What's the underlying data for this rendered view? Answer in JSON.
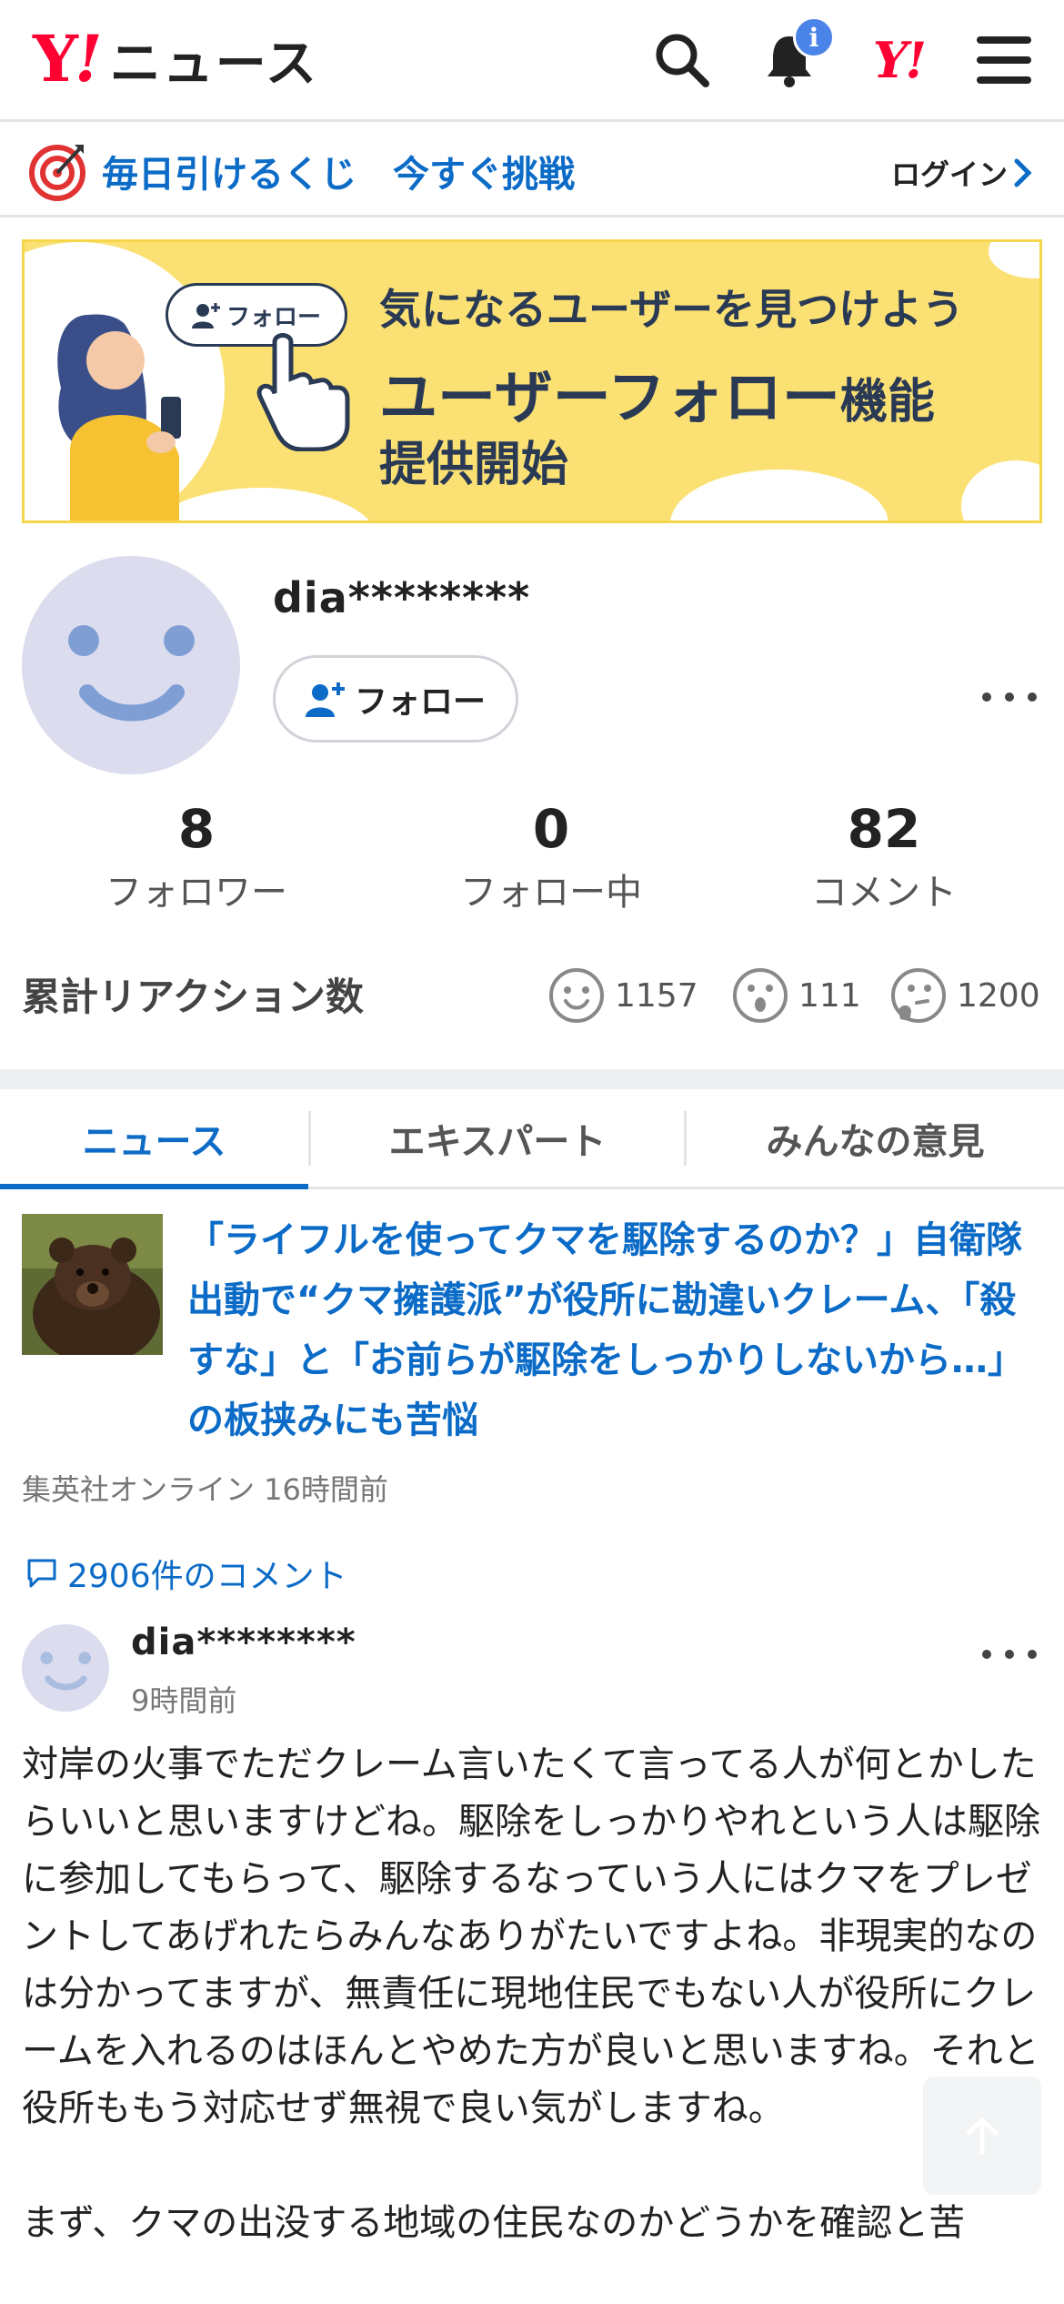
{
  "header": {
    "logo_y": "Y",
    "logo_excl": "!",
    "logo_text": "ニュース",
    "notification_badge": "i",
    "yahoo_mark": "Y!"
  },
  "lottery": {
    "text": "毎日引けるくじ　今すぐ挑戦",
    "login_label": "ログイン"
  },
  "banner": {
    "pill_label": "フォロー",
    "line1": "気になるユーザーを見つけよう",
    "line2_main": "ユーザーフォロー",
    "line2_small": "機能",
    "line3": "提供開始"
  },
  "profile": {
    "username": "dia********",
    "follow_label": "フォロー",
    "stats": [
      {
        "value": "8",
        "label": "フォロワー"
      },
      {
        "value": "0",
        "label": "フォロー中"
      },
      {
        "value": "82",
        "label": "コメント"
      }
    ],
    "reactions_title": "累計リアクション数",
    "reactions": [
      {
        "icon": "smile-icon",
        "count": "1157"
      },
      {
        "icon": "surprised-icon",
        "count": "111"
      },
      {
        "icon": "thinking-icon",
        "count": "1200"
      }
    ]
  },
  "tabs": [
    {
      "label": "ニュース",
      "active": true
    },
    {
      "label": "エキスパート",
      "active": false
    },
    {
      "label": "みんなの意見",
      "active": false
    }
  ],
  "article": {
    "title": "「ライフルを使ってクマを駆除するのか？」自衛隊出動で“クマ擁護派”が役所に勘違いクレーム、「殺すな」と「お前らが駆除をしっかりしないから…」の板挟みにも苦悩",
    "source": "集英社オンライン 16時間前",
    "comment_count": "2906件のコメント"
  },
  "comment": {
    "username": "dia********",
    "time": "9時間前",
    "body1": "対岸の火事でただクレーム言いたくて言ってる人が何とかしたらいいと思いますけどね。駆除をしっかりやれという人は駆除に参加してもらって、駆除するなっていう人にはクマをプレゼントしてあげれたらみんなありがたいですよね。非現実的なのは分かってますが、無責任に現地住民でもない人が役所にクレームを入れるのはほんとやめた方が良いと思いますね。それと役所ももう対応せず無視で良い気がしますね。",
    "body2": "まず、クマの出没する地域の住民なのかどうかを確認と苦"
  },
  "colors": {
    "brand_red": "#ff0033",
    "link_blue": "#0b6bc7",
    "banner_yellow": "#fbe173",
    "avatar_lavender": "#dcdcef"
  }
}
